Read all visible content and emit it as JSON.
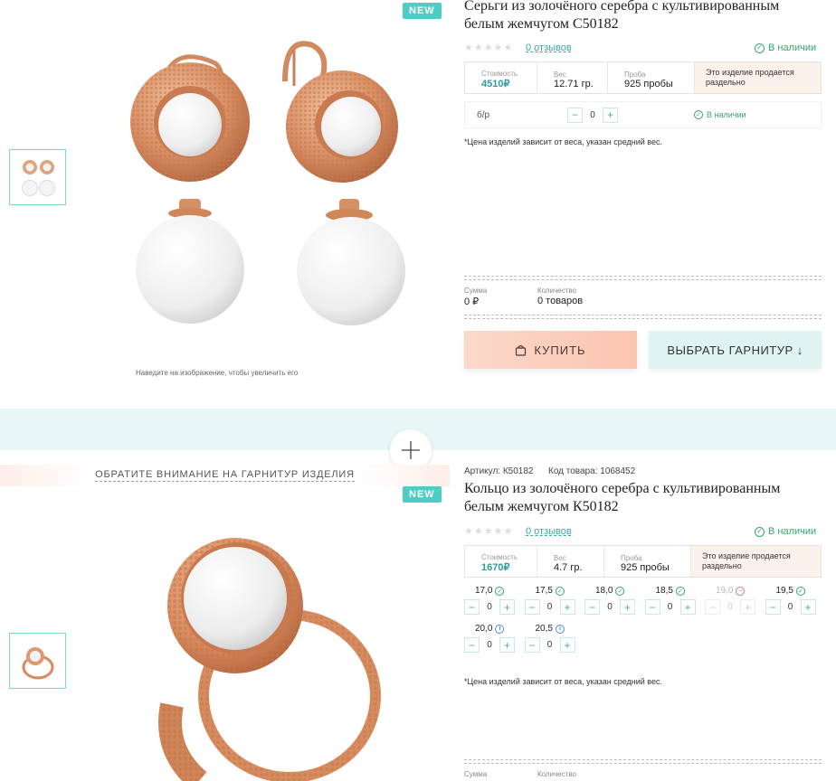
{
  "product1": {
    "badge": "NEW",
    "title_line1": "Серьги из золочёного серебра с культивированным",
    "title_line2": "белым жемчугом С50182",
    "reviews": "0 отзывов",
    "in_stock": "В наличии",
    "price_label": "Стоимость",
    "price": "4510₽",
    "weight_label": "Вес",
    "weight": "12.71 гр.",
    "probe_label": "Проба",
    "probe": "925 пробы",
    "note_separate": "Это изделие продается раздельно",
    "variant_label": "б/р",
    "variant_qty": "0",
    "variant_stock": "В наличии",
    "price_note": "*Цена изделий зависит от веса, указан средний вес.",
    "sum_label": "Сумма",
    "sum_value": "0 ₽",
    "qty_label": "Количество",
    "qty_value": "0 товаров",
    "buy_label": "КУПИТЬ",
    "set_label": "ВЫБРАТЬ ГАРНИТУР",
    "zoom_hint": "Наведите на изображение, чтобы увеличить его"
  },
  "notice": "ОБРАТИТЕ ВНИМАНИЕ НА ГАРНИТУР ИЗДЕЛИЯ",
  "product2": {
    "badge": "NEW",
    "article": "Артикул: К50182",
    "code": "Код товара: 1068452",
    "title_line1": "Кольцо из золочёного серебра с культивированным",
    "title_line2": "белым жемчугом К50182",
    "reviews": "0 отзывов",
    "in_stock": "В наличии",
    "price_label": "Стоимость",
    "price": "1670₽",
    "weight_label": "Вес",
    "weight": "4.7 гр.",
    "probe_label": "Проба",
    "probe": "925 пробы",
    "note_separate": "Это изделие продается раздельно",
    "sizes": [
      {
        "size": "17,0",
        "qty": "0",
        "status": "ok"
      },
      {
        "size": "17,5",
        "qty": "0",
        "status": "ok"
      },
      {
        "size": "18,0",
        "qty": "0",
        "status": "ok"
      },
      {
        "size": "18,5",
        "qty": "0",
        "status": "ok"
      },
      {
        "size": "19,0",
        "qty": "0",
        "status": "no"
      },
      {
        "size": "19,5",
        "qty": "0",
        "status": "ok"
      },
      {
        "size": "20,0",
        "qty": "0",
        "status": "info"
      },
      {
        "size": "20,5",
        "qty": "0",
        "status": "info"
      }
    ],
    "price_note": "*Цена изделий зависит от веса, указан средний вес.",
    "sum_label": "Сумма",
    "qty_label": "Количество"
  },
  "colors": {
    "accent": "#4ecdc4",
    "link": "#3aa6a6",
    "stock": "#3aa36b",
    "buy_bg": "#fbc4b0",
    "set_bg": "#dff3f1"
  }
}
